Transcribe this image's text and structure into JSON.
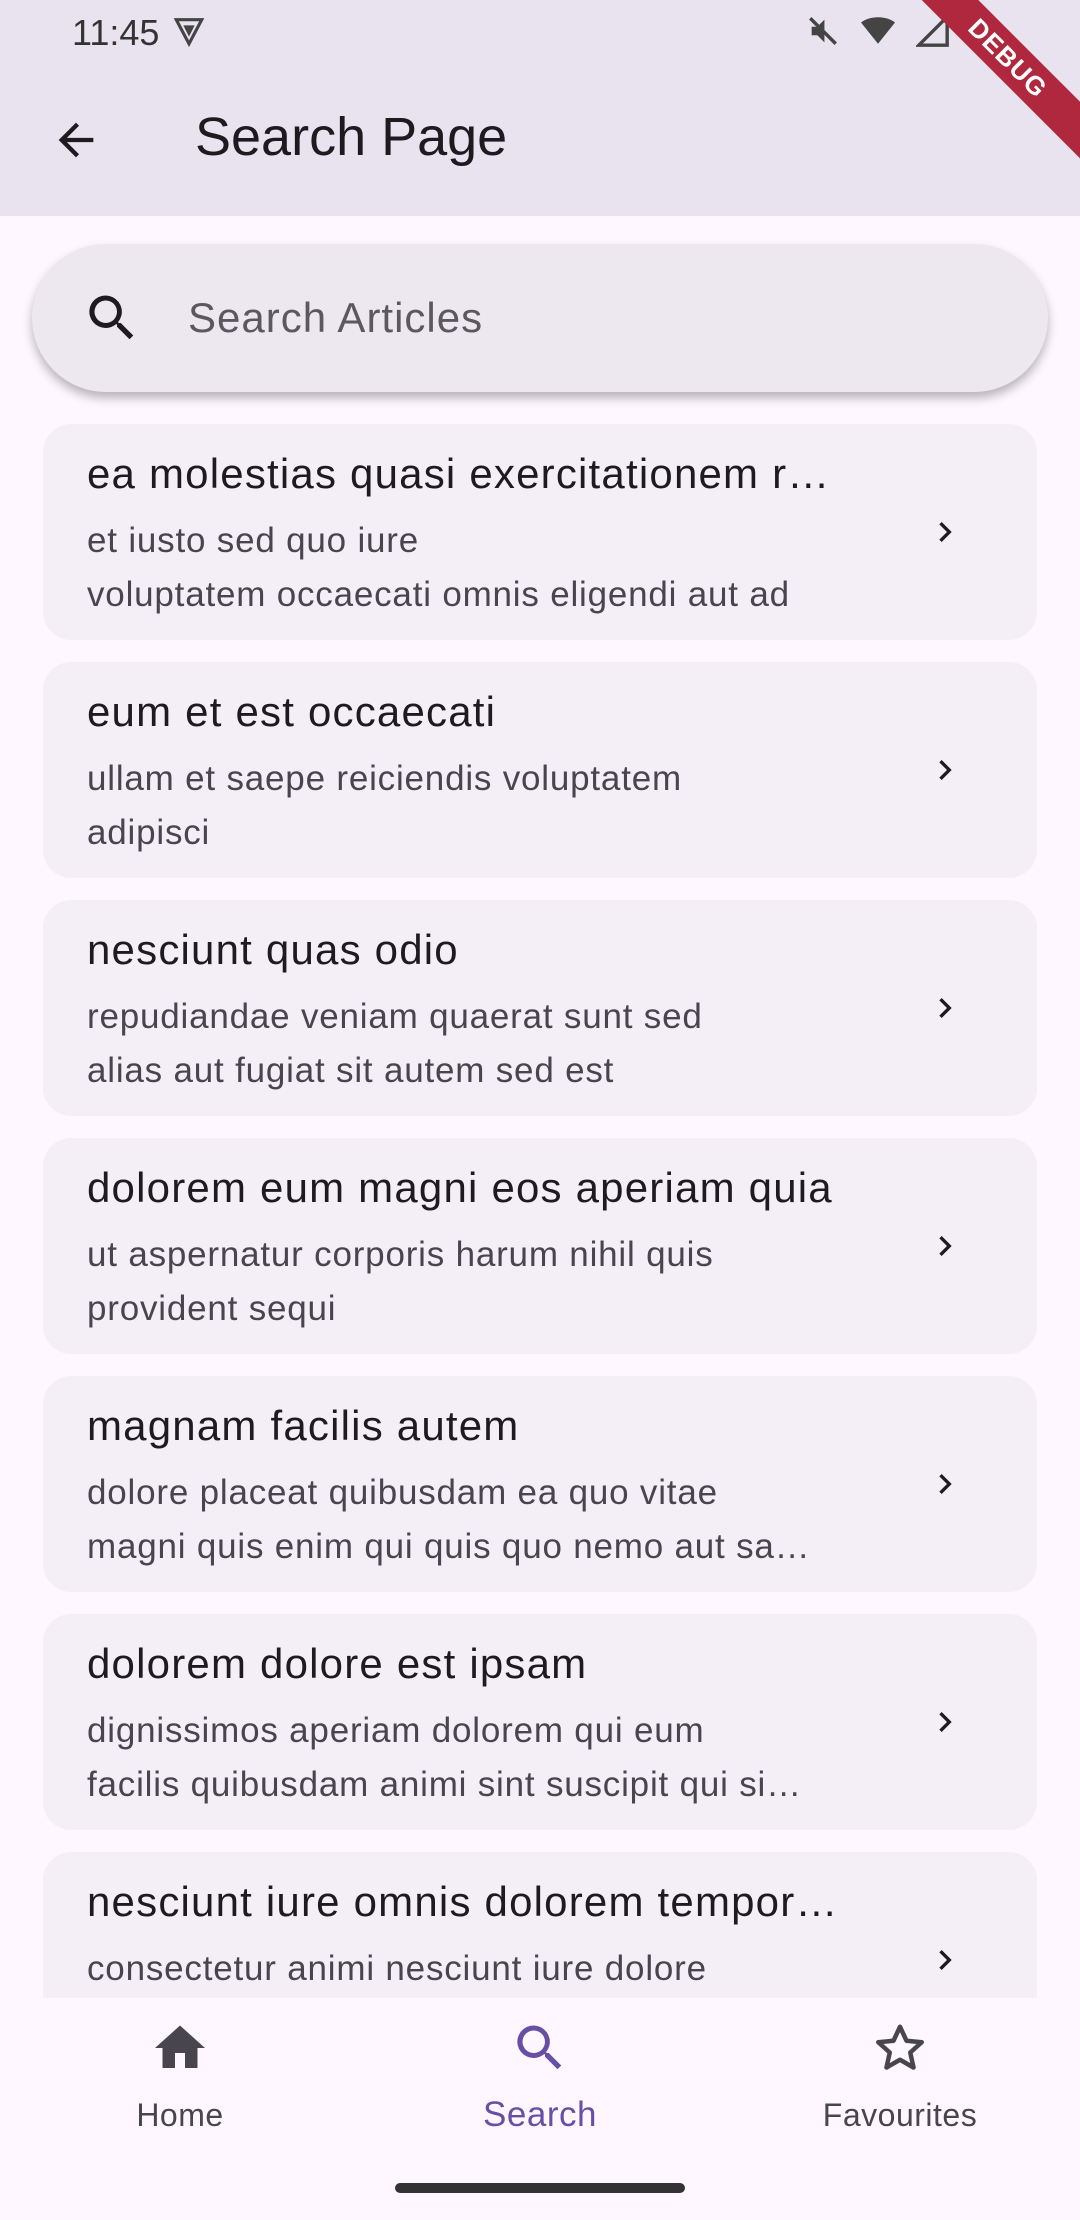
{
  "status_bar": {
    "time": "11:45",
    "debug_label": "DEBUG"
  },
  "app_bar": {
    "title": "Search Page"
  },
  "search": {
    "placeholder": "Search Articles",
    "value": ""
  },
  "articles": [
    {
      "title": "ea molestias quasi exercitationem r…",
      "body_line1": "et iusto sed quo iure",
      "body_line2": "voluptatem occaecati omnis eligendi aut ad"
    },
    {
      "title": "eum et est occaecati",
      "body_line1": "ullam et saepe reiciendis voluptatem",
      "body_line2": "adipisci"
    },
    {
      "title": "nesciunt quas odio",
      "body_line1": "repudiandae veniam quaerat sunt sed",
      "body_line2": "alias aut fugiat sit autem sed est"
    },
    {
      "title": "dolorem eum magni eos aperiam quia",
      "body_line1": "ut aspernatur corporis harum nihil quis",
      "body_line2": "provident sequi"
    },
    {
      "title": "magnam facilis autem",
      "body_line1": "dolore placeat quibusdam ea quo vitae",
      "body_line2": "magni quis enim qui quis quo nemo aut sa…"
    },
    {
      "title": "dolorem dolore est ipsam",
      "body_line1": "dignissimos aperiam dolorem qui eum",
      "body_line2": "facilis quibusdam animi sint suscipit qui si…"
    },
    {
      "title": "nesciunt iure omnis dolorem tempor…",
      "body_line1": "consectetur animi nesciunt iure dolore",
      "body_line2": ""
    }
  ],
  "bottom_nav": {
    "items": [
      {
        "label": "Home",
        "icon": "home-icon",
        "active": false
      },
      {
        "label": "Search",
        "icon": "search-icon",
        "active": true
      },
      {
        "label": "Favourites",
        "icon": "star-icon",
        "active": false
      }
    ]
  },
  "colors": {
    "accent": "#6750a4",
    "app_bar": "#e8e3ee",
    "card": "#f4eff6",
    "background": "#fef7ff"
  }
}
